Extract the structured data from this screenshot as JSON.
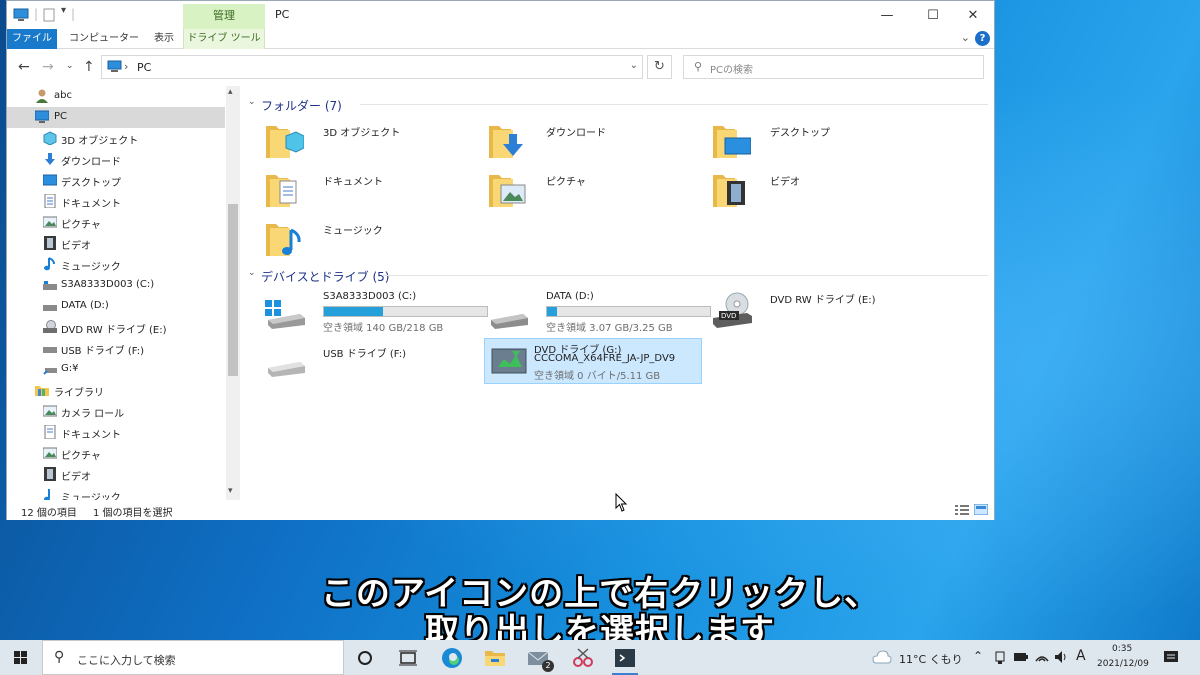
{
  "window": {
    "title": "PC",
    "context_group": "管理",
    "controls": {
      "minimize": "—",
      "maximize": "☐",
      "close": "✕"
    }
  },
  "ribbon": {
    "tabs": [
      "ファイル",
      "コンピューター",
      "表示",
      "ドライブ ツール"
    ],
    "help": "?"
  },
  "nav": {
    "address": "PC",
    "search_placeholder": "PCの検索"
  },
  "sidebar": {
    "items": [
      {
        "label": "abc",
        "icon": "user-icon"
      },
      {
        "label": "PC",
        "icon": "pc-icon"
      },
      {
        "label": "3D オブジェクト",
        "icon": "cube-icon"
      },
      {
        "label": "ダウンロード",
        "icon": "download-arrow-icon"
      },
      {
        "label": "デスクトップ",
        "icon": "desktop-icon"
      },
      {
        "label": "ドキュメント",
        "icon": "document-icon"
      },
      {
        "label": "ピクチャ",
        "icon": "picture-icon"
      },
      {
        "label": "ビデオ",
        "icon": "video-icon"
      },
      {
        "label": "ミュージック",
        "icon": "music-note-icon"
      },
      {
        "label": "S3A8333D003 (C:)",
        "icon": "drive-icon"
      },
      {
        "label": "DATA (D:)",
        "icon": "drive-icon"
      },
      {
        "label": "DVD RW ドライブ (E:)",
        "icon": "dvd-drive-icon"
      },
      {
        "label": "USB ドライブ (F:)",
        "icon": "usb-drive-icon"
      },
      {
        "label": "G:¥",
        "icon": "network-drive-icon"
      },
      {
        "label": "ライブラリ",
        "icon": "library-icon"
      },
      {
        "label": "カメラ ロール",
        "icon": "picture-icon"
      },
      {
        "label": "ドキュメント",
        "icon": "document-icon"
      },
      {
        "label": "ピクチャ",
        "icon": "picture-icon"
      },
      {
        "label": "ビデオ",
        "icon": "video-icon"
      },
      {
        "label": "ミュージック",
        "icon": "music-note-icon"
      }
    ]
  },
  "content": {
    "folders_header": "フォルダー (7)",
    "folders": [
      {
        "label": "3D オブジェクト",
        "icon": "folder-3d-icon"
      },
      {
        "label": "ダウンロード",
        "icon": "folder-download-icon"
      },
      {
        "label": "デスクトップ",
        "icon": "folder-desktop-icon"
      },
      {
        "label": "ドキュメント",
        "icon": "folder-documents-icon"
      },
      {
        "label": "ピクチャ",
        "icon": "folder-pictures-icon"
      },
      {
        "label": "ビデオ",
        "icon": "folder-videos-icon"
      },
      {
        "label": "ミュージック",
        "icon": "folder-music-icon"
      }
    ],
    "devices_header": "デバイスとドライブ (5)",
    "drives": [
      {
        "name": "S3A8333D003 (C:)",
        "free": "空き領域 140 GB/218 GB",
        "used_fraction": 0.36,
        "icon": "windows-drive-icon"
      },
      {
        "name": "DATA (D:)",
        "free": "空き領域 3.07 GB/3.25 GB",
        "used_fraction": 0.06,
        "icon": "drive-icon"
      },
      {
        "name": "DVD RW ドライブ (E:)",
        "icon": "dvd-rw-drive-icon"
      },
      {
        "name": "USB ドライブ (F:)",
        "icon": "usb-drive-icon"
      },
      {
        "name": "DVD ドライブ (G:)",
        "label2": "CCCOMA_X64FRE_JA-JP_DV9",
        "free": "空き領域 0 バイト/5.11 GB",
        "icon": "dvd-drive-disc-icon"
      }
    ]
  },
  "status": {
    "count": "12 個の項目",
    "selected": "1 個の項目を選択"
  },
  "subtitle": {
    "line1": "このアイコンの上で右クリックし、",
    "line2": "取り出しを選択します"
  },
  "taskbar": {
    "search_placeholder": "ここに入力して検索",
    "mail_badge": "2",
    "weather": "11°C くもり",
    "ime": "A",
    "time": "0:35",
    "date": "2021/12/09"
  },
  "colors": {
    "accent": "#1979ca",
    "selection": "#cce8ff",
    "bar_fill": "#26a0da",
    "context_tab": "#d9f2c4"
  }
}
